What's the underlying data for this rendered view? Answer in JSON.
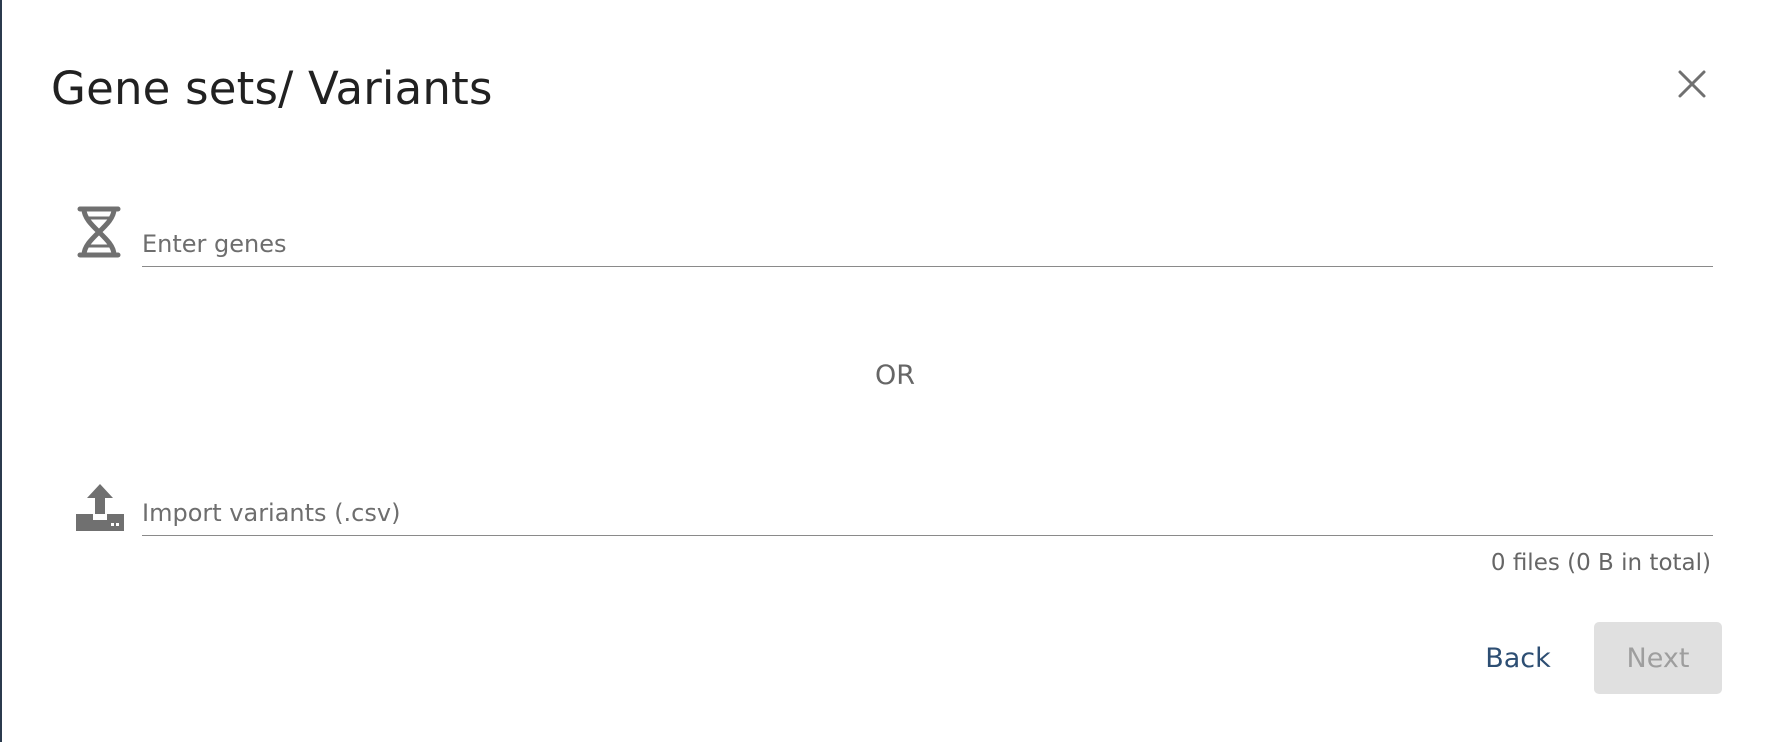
{
  "dialog": {
    "title": "Gene sets/ Variants"
  },
  "genes_field": {
    "placeholder": "Enter genes",
    "value": ""
  },
  "separator": {
    "label": "OR"
  },
  "import_field": {
    "placeholder": "Import variants (.csv)",
    "value": ""
  },
  "files_summary": "0 files (0 B in total)",
  "actions": {
    "back_label": "Back",
    "next_label": "Next"
  },
  "icons": {
    "close": "close-icon",
    "genes": "dna-icon",
    "import": "upload-icon"
  },
  "colors": {
    "title": "#212121",
    "primary": "#2d4e73",
    "disabled_bg": "#e0e0e0",
    "disabled_text": "#9e9e9e",
    "icon": "#707070"
  }
}
